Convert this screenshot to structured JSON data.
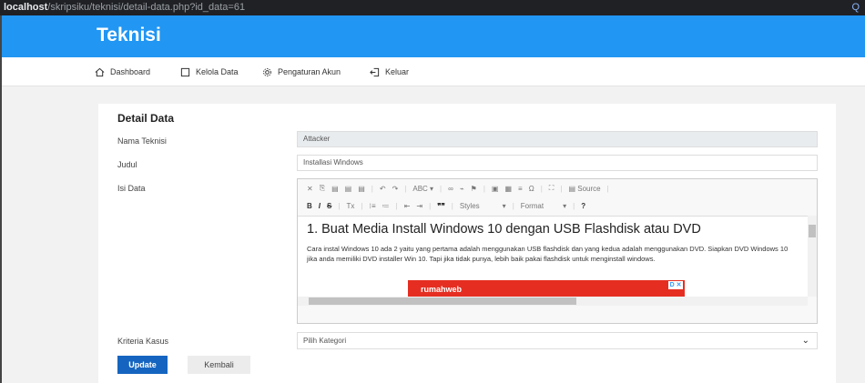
{
  "browser": {
    "url_host": "localhost",
    "url_path": "/skripsiku/teknisi/detail-data.php?id_data=61",
    "zoom_icon": "Q"
  },
  "header": {
    "brand": "Teknisi"
  },
  "nav": [
    {
      "label": "Dashboard",
      "icon": "home-icon"
    },
    {
      "label": "Kelola Data",
      "icon": "square-icon"
    },
    {
      "label": "Pengaturan Akun",
      "icon": "gear-icon"
    },
    {
      "label": "Keluar",
      "icon": "logout-icon"
    }
  ],
  "form": {
    "title": "Detail Data",
    "nama_label": "Nama Teknisi",
    "nama_value": "Attacker",
    "judul_label": "Judul",
    "judul_value": "Installasi Windows",
    "isi_label": "Isi Data",
    "kriteria_label": "Kriteria Kasus",
    "kriteria_value": "Pilih Kategori",
    "update_label": "Update",
    "back_label": "Kembali"
  },
  "editor": {
    "toolbar_row1": [
      "✕",
      "⎘",
      "▤",
      "▤",
      "▤",
      "|",
      "↶",
      "↷",
      "|",
      "ABC ▾",
      "|",
      "∞",
      "⌁",
      "⚑",
      "|",
      "▣",
      "▦",
      "≡",
      "Ω",
      "|",
      "⛶",
      "|",
      "▤ Source",
      "|"
    ],
    "toolbar_row2": [
      "B",
      "I",
      "S",
      "|",
      "Tx",
      "|",
      "⁝≡",
      "≔",
      "|",
      "⇤",
      "⇥",
      "|",
      "❞❞",
      "|",
      "Styles",
      "▾",
      "|",
      "Format",
      "▾",
      "|",
      "?"
    ],
    "heading": "1. Buat Media Install Windows 10 dengan USB Flashdisk atau DVD",
    "paragraph": "Cara instal Windows 10 ada 2 yaitu yang pertama adalah menggunakan USB flashdisk dan yang kedua adalah menggunakan DVD. Siapkan DVD Windows 10 jika anda memiliki DVD installer Win 10. Tapi jika tidak punya, lebih baik pakai flashdisk untuk menginstall windows.",
    "ad_text": "rumahweb",
    "ad_close": "D ✕"
  },
  "colors": {
    "brand_blue": "#2196f3",
    "button_blue": "#1565c0",
    "ad_red": "#e52e21"
  }
}
